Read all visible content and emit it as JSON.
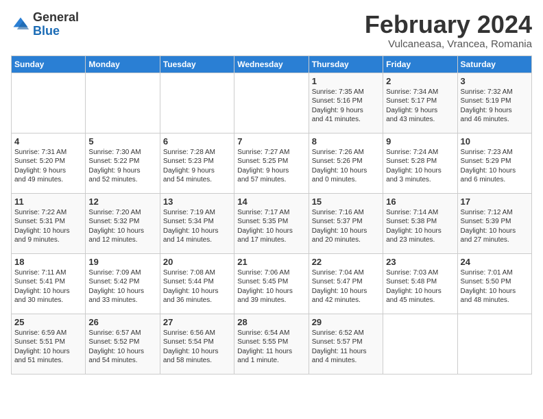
{
  "header": {
    "logo_general": "General",
    "logo_blue": "Blue",
    "title": "February 2024",
    "subtitle": "Vulcaneasa, Vrancea, Romania"
  },
  "weekdays": [
    "Sunday",
    "Monday",
    "Tuesday",
    "Wednesday",
    "Thursday",
    "Friday",
    "Saturday"
  ],
  "weeks": [
    [
      {
        "day": "",
        "info": ""
      },
      {
        "day": "",
        "info": ""
      },
      {
        "day": "",
        "info": ""
      },
      {
        "day": "",
        "info": ""
      },
      {
        "day": "1",
        "info": "Sunrise: 7:35 AM\nSunset: 5:16 PM\nDaylight: 9 hours\nand 41 minutes."
      },
      {
        "day": "2",
        "info": "Sunrise: 7:34 AM\nSunset: 5:17 PM\nDaylight: 9 hours\nand 43 minutes."
      },
      {
        "day": "3",
        "info": "Sunrise: 7:32 AM\nSunset: 5:19 PM\nDaylight: 9 hours\nand 46 minutes."
      }
    ],
    [
      {
        "day": "4",
        "info": "Sunrise: 7:31 AM\nSunset: 5:20 PM\nDaylight: 9 hours\nand 49 minutes."
      },
      {
        "day": "5",
        "info": "Sunrise: 7:30 AM\nSunset: 5:22 PM\nDaylight: 9 hours\nand 52 minutes."
      },
      {
        "day": "6",
        "info": "Sunrise: 7:28 AM\nSunset: 5:23 PM\nDaylight: 9 hours\nand 54 minutes."
      },
      {
        "day": "7",
        "info": "Sunrise: 7:27 AM\nSunset: 5:25 PM\nDaylight: 9 hours\nand 57 minutes."
      },
      {
        "day": "8",
        "info": "Sunrise: 7:26 AM\nSunset: 5:26 PM\nDaylight: 10 hours\nand 0 minutes."
      },
      {
        "day": "9",
        "info": "Sunrise: 7:24 AM\nSunset: 5:28 PM\nDaylight: 10 hours\nand 3 minutes."
      },
      {
        "day": "10",
        "info": "Sunrise: 7:23 AM\nSunset: 5:29 PM\nDaylight: 10 hours\nand 6 minutes."
      }
    ],
    [
      {
        "day": "11",
        "info": "Sunrise: 7:22 AM\nSunset: 5:31 PM\nDaylight: 10 hours\nand 9 minutes."
      },
      {
        "day": "12",
        "info": "Sunrise: 7:20 AM\nSunset: 5:32 PM\nDaylight: 10 hours\nand 12 minutes."
      },
      {
        "day": "13",
        "info": "Sunrise: 7:19 AM\nSunset: 5:34 PM\nDaylight: 10 hours\nand 14 minutes."
      },
      {
        "day": "14",
        "info": "Sunrise: 7:17 AM\nSunset: 5:35 PM\nDaylight: 10 hours\nand 17 minutes."
      },
      {
        "day": "15",
        "info": "Sunrise: 7:16 AM\nSunset: 5:37 PM\nDaylight: 10 hours\nand 20 minutes."
      },
      {
        "day": "16",
        "info": "Sunrise: 7:14 AM\nSunset: 5:38 PM\nDaylight: 10 hours\nand 23 minutes."
      },
      {
        "day": "17",
        "info": "Sunrise: 7:12 AM\nSunset: 5:39 PM\nDaylight: 10 hours\nand 27 minutes."
      }
    ],
    [
      {
        "day": "18",
        "info": "Sunrise: 7:11 AM\nSunset: 5:41 PM\nDaylight: 10 hours\nand 30 minutes."
      },
      {
        "day": "19",
        "info": "Sunrise: 7:09 AM\nSunset: 5:42 PM\nDaylight: 10 hours\nand 33 minutes."
      },
      {
        "day": "20",
        "info": "Sunrise: 7:08 AM\nSunset: 5:44 PM\nDaylight: 10 hours\nand 36 minutes."
      },
      {
        "day": "21",
        "info": "Sunrise: 7:06 AM\nSunset: 5:45 PM\nDaylight: 10 hours\nand 39 minutes."
      },
      {
        "day": "22",
        "info": "Sunrise: 7:04 AM\nSunset: 5:47 PM\nDaylight: 10 hours\nand 42 minutes."
      },
      {
        "day": "23",
        "info": "Sunrise: 7:03 AM\nSunset: 5:48 PM\nDaylight: 10 hours\nand 45 minutes."
      },
      {
        "day": "24",
        "info": "Sunrise: 7:01 AM\nSunset: 5:50 PM\nDaylight: 10 hours\nand 48 minutes."
      }
    ],
    [
      {
        "day": "25",
        "info": "Sunrise: 6:59 AM\nSunset: 5:51 PM\nDaylight: 10 hours\nand 51 minutes."
      },
      {
        "day": "26",
        "info": "Sunrise: 6:57 AM\nSunset: 5:52 PM\nDaylight: 10 hours\nand 54 minutes."
      },
      {
        "day": "27",
        "info": "Sunrise: 6:56 AM\nSunset: 5:54 PM\nDaylight: 10 hours\nand 58 minutes."
      },
      {
        "day": "28",
        "info": "Sunrise: 6:54 AM\nSunset: 5:55 PM\nDaylight: 11 hours\nand 1 minute."
      },
      {
        "day": "29",
        "info": "Sunrise: 6:52 AM\nSunset: 5:57 PM\nDaylight: 11 hours\nand 4 minutes."
      },
      {
        "day": "",
        "info": ""
      },
      {
        "day": "",
        "info": ""
      }
    ]
  ]
}
